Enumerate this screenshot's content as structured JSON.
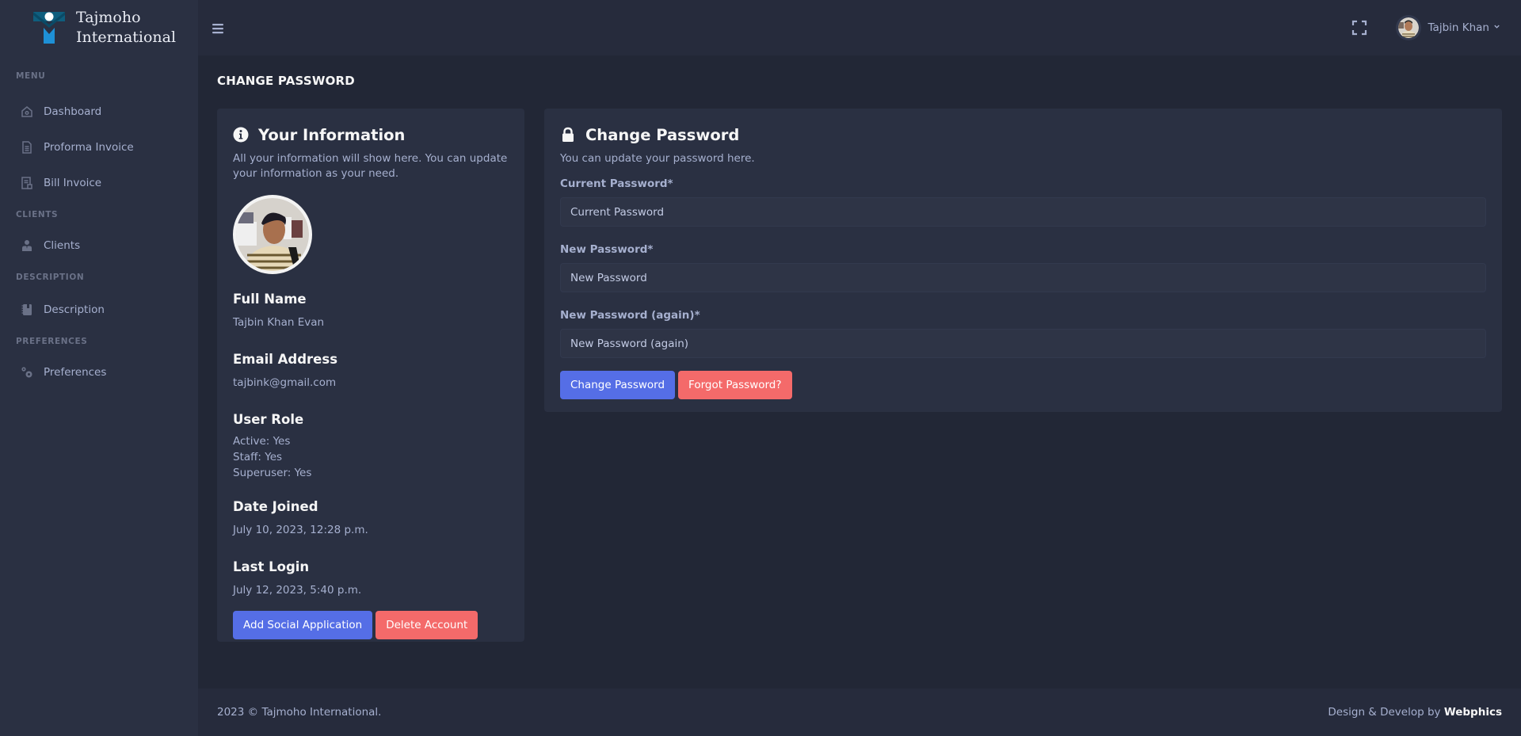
{
  "brand": {
    "name_line1": "Tajmoho",
    "name_line2": "International",
    "logo_colors": {
      "bar": "#0f5e7e",
      "stem": "#1e90d6",
      "dot": "#ffffff"
    }
  },
  "sidebar": {
    "sections": [
      {
        "title": "MENU",
        "items": [
          {
            "label": "Dashboard",
            "icon": "home-icon"
          },
          {
            "label": "Proforma Invoice",
            "icon": "document-icon"
          },
          {
            "label": "Bill Invoice",
            "icon": "receipt-icon"
          }
        ]
      },
      {
        "title": "CLIENTS",
        "items": [
          {
            "label": "Clients",
            "icon": "user-tie-icon"
          }
        ]
      },
      {
        "title": "DESCRIPTION",
        "items": [
          {
            "label": "Description",
            "icon": "notebook-icon"
          }
        ]
      },
      {
        "title": "PREFERENCES",
        "items": [
          {
            "label": "Preferences",
            "icon": "gears-icon"
          }
        ]
      }
    ]
  },
  "header": {
    "user_name": "Tajbin Khan",
    "caret": "⌄"
  },
  "page": {
    "title": "CHANGE PASSWORD"
  },
  "info_card": {
    "title": "Your Information",
    "subtitle": "All your information will show here. You can update your information as your need.",
    "fields": {
      "full_name": {
        "label": "Full Name",
        "value": "Tajbin Khan Evan"
      },
      "email": {
        "label": "Email Address",
        "value": "tajbink@gmail.com"
      },
      "role": {
        "label": "User Role",
        "active": "Active: Yes",
        "staff": "Staff: Yes",
        "superuser": "Superuser: Yes"
      },
      "date_joined": {
        "label": "Date Joined",
        "value": "July 10, 2023, 12:28 p.m."
      },
      "last_login": {
        "label": "Last Login",
        "value": "July 12, 2023, 5:40 p.m."
      }
    },
    "buttons": {
      "add_social": "Add Social Application",
      "delete_account": "Delete Account"
    }
  },
  "password_card": {
    "title": "Change Password",
    "subtitle": "You can update your password here.",
    "current": {
      "label": "Current Password*",
      "placeholder": "Current Password",
      "value": ""
    },
    "new": {
      "label": "New Password*",
      "placeholder": "New Password",
      "value": ""
    },
    "again": {
      "label": "New Password (again)*",
      "placeholder": "New Password (again)",
      "value": ""
    },
    "buttons": {
      "change": "Change Password",
      "forgot": "Forgot Password?"
    }
  },
  "footer": {
    "copyright": "2023 © Tajmoho International.",
    "credit_prefix": "Design & Develop by ",
    "credit_brand": "Webphics"
  },
  "colors": {
    "primary": "#556ee6",
    "danger": "#f46a6a",
    "sidebar_bg": "#2a3042",
    "body_bg": "#222736"
  }
}
